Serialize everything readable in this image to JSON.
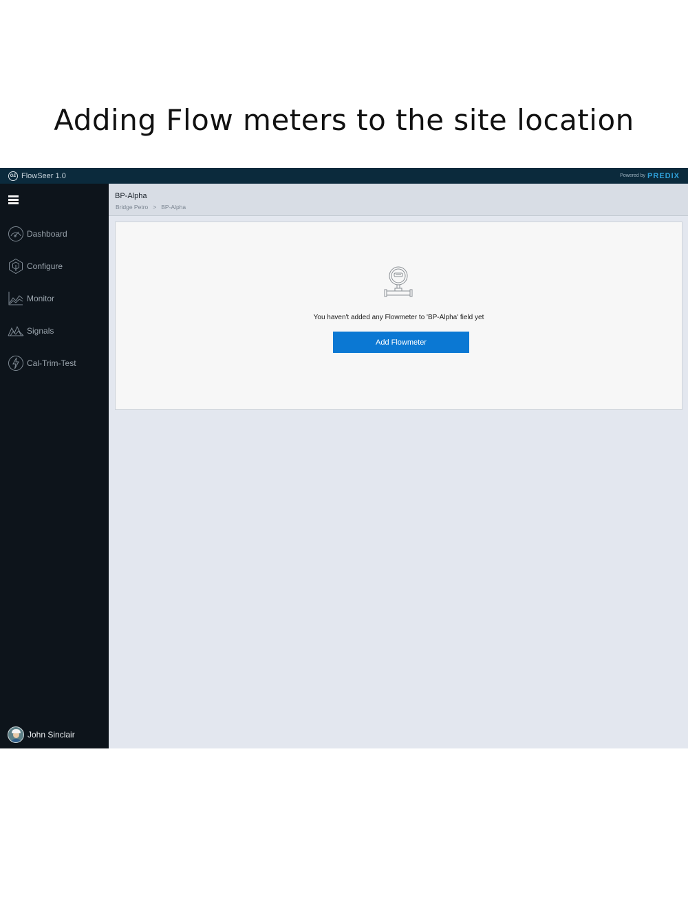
{
  "slide": {
    "title": "Adding Flow meters to the site location"
  },
  "topbar": {
    "logo_text": "GE",
    "app_name": "FlowSeer 1.0",
    "powered_by": "Powered by",
    "brand": "PREDIX"
  },
  "sidebar": {
    "items": [
      {
        "label": "Dashboard",
        "icon": "dashboard-gauge-icon"
      },
      {
        "label": "Configure",
        "icon": "configure-hexagon-icon"
      },
      {
        "label": "Monitor",
        "icon": "monitor-chart-icon"
      },
      {
        "label": "Signals",
        "icon": "signals-waveform-icon"
      },
      {
        "label": "Cal-Trim-Test",
        "icon": "cal-trim-test-bolt-icon"
      }
    ],
    "user_name": "John Sinclair"
  },
  "header": {
    "title": "BP-Alpha",
    "breadcrumb": [
      "Bridge Petro",
      "BP-Alpha"
    ],
    "separator": ">"
  },
  "empty_state": {
    "message": "You haven't added any Flowmeter to  'BP-Alpha' field  yet",
    "button_label": "Add Flowmeter",
    "icon": "flowmeter-icon"
  },
  "colors": {
    "topbar": "#0b2a3c",
    "sidebar": "#0d141b",
    "content_bg": "#e3e7ef",
    "button": "#0b78d3",
    "brand": "#2f9fd8"
  }
}
